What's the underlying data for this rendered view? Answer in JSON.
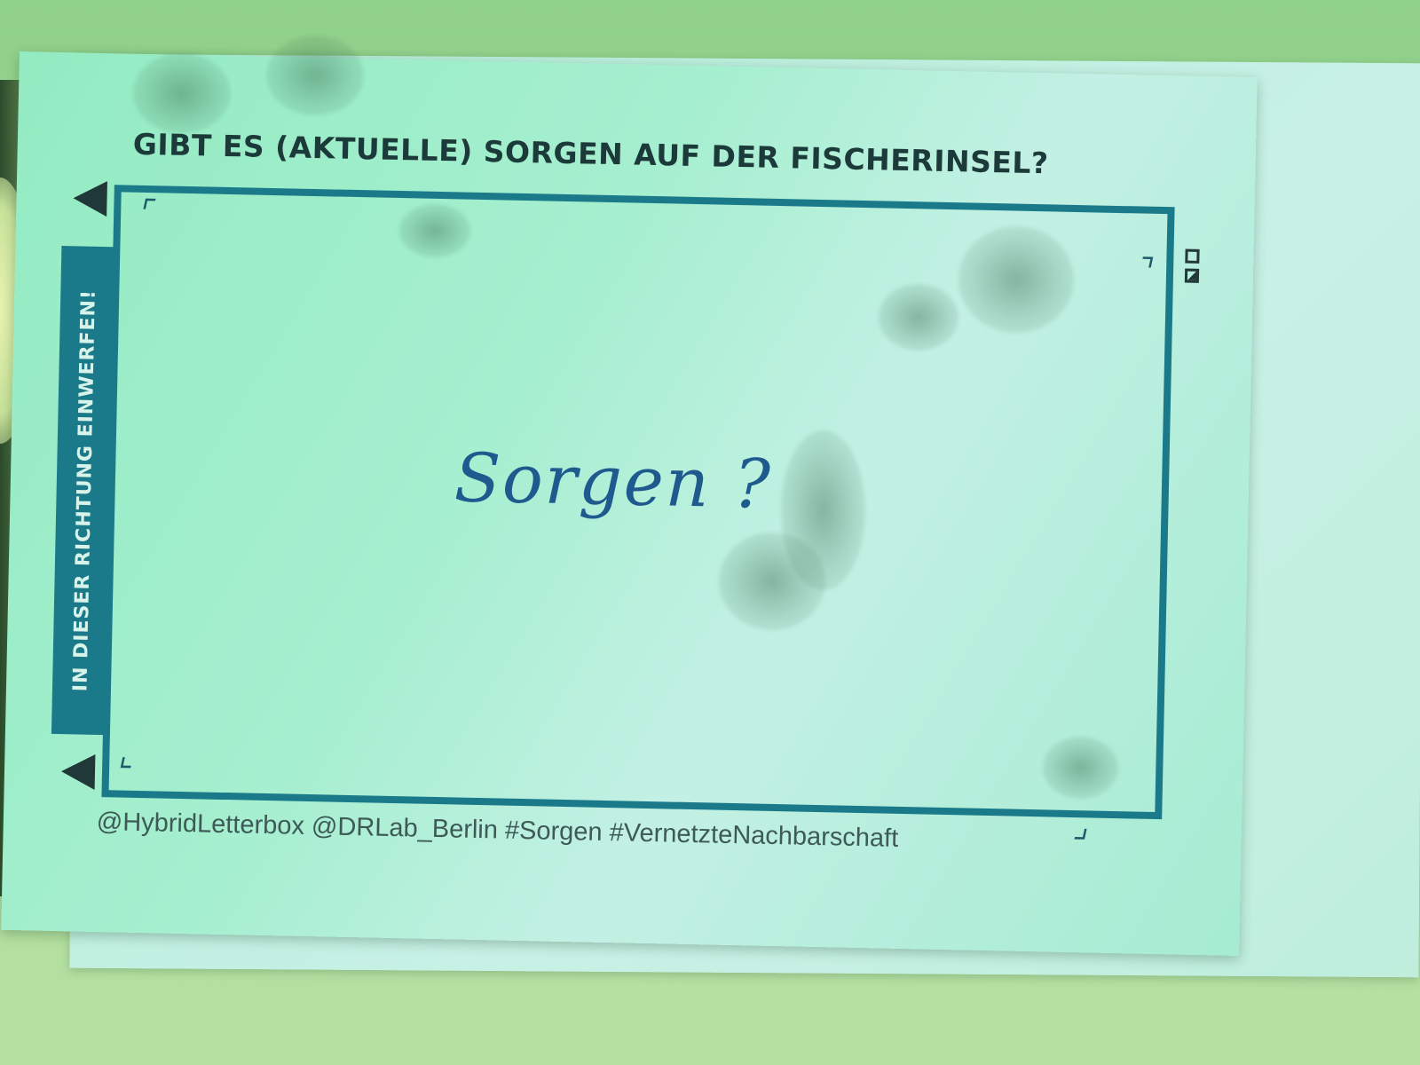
{
  "card": {
    "title": "GIBT ES (AKTUELLE) SORGEN AUF DER FISCHERINSEL?",
    "side_label": "IN DIESER RICHTUNG EINWERFEN!",
    "handwritten_answer": "Sorgen ?",
    "footer": "@HybridLetterbox @DRLab_Berlin #Sorgen #VernetzteNachbarschaft",
    "accent_color": "#1b7a8a",
    "ink_color": "#1f5a8f"
  }
}
